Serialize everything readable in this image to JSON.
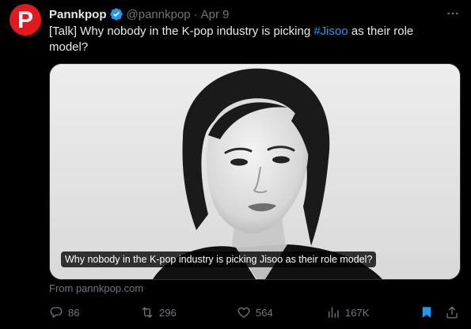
{
  "tweet": {
    "avatar_letter": "P",
    "name": "Pannkpop",
    "handle": "@pannkpop",
    "separator": "·",
    "date": "Apr 9",
    "text_before": "[Talk] Why nobody in the K-pop industry is picking ",
    "hashtag": "#Jisoo",
    "text_after": " as their role model?",
    "media_caption": "Why nobody in the K-pop industry is picking Jisoo as their role model?",
    "source": "From pannkpop.com"
  },
  "actions": {
    "replies": "86",
    "reposts": "296",
    "likes": "564",
    "views": "167K"
  },
  "colors": {
    "background": "#000000",
    "brand_red": "#e4181f",
    "link_blue": "#1d9bf0",
    "muted": "#71767b"
  },
  "icons": [
    "verified-badge-icon",
    "more-icon",
    "reply-icon",
    "repost-icon",
    "like-icon",
    "views-icon",
    "bookmark-icon",
    "share-icon"
  ]
}
